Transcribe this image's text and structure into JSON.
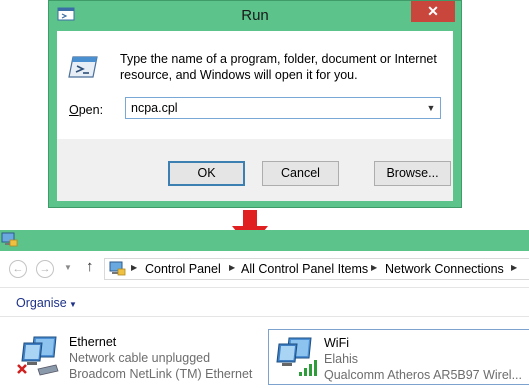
{
  "run_dialog": {
    "title": "Run",
    "close_glyph": "✕",
    "description": "Type the name of a program, folder, document or Internet resource, and Windows will open it for you.",
    "open_label_accel": "O",
    "open_label_rest": "pen:",
    "open_value": "ncpa.cpl",
    "ok_label": "OK",
    "cancel_label": "Cancel",
    "browse_label": "Browse...",
    "colors": {
      "frame": "#5cc48a",
      "close": "#c9463d"
    }
  },
  "arrow": {
    "color": "#e02020",
    "icon": "down-arrow-icon"
  },
  "explorer": {
    "breadcrumb": [
      "Control Panel",
      "All Control Panel Items",
      "Network Connections"
    ],
    "organise_label": "Organise",
    "connections": [
      {
        "name": "Ethernet",
        "status": "Network cable unplugged",
        "device": "Broadcom NetLink (TM) Ethernet",
        "icon": "ethernet-disconnected-icon"
      },
      {
        "name": "WiFi",
        "status": "Elahis",
        "device": "Qualcomm Atheros AR5B97 Wirel...",
        "icon": "wifi-signal-icon"
      }
    ]
  }
}
